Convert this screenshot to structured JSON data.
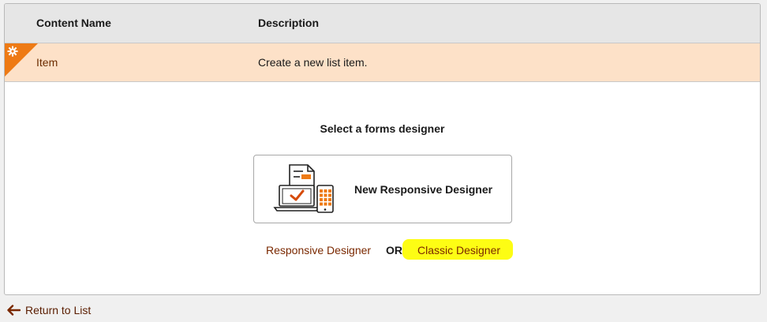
{
  "table": {
    "headers": {
      "content_name": "Content Name",
      "description": "Description"
    },
    "rows": [
      {
        "name": "Item",
        "description": "Create a new list item."
      }
    ]
  },
  "designer": {
    "title": "Select a forms designer",
    "card_label": "New Responsive Designer",
    "responsive_link": "Responsive Designer",
    "or_text": "OR",
    "classic_link": "Classic Designer"
  },
  "footer": {
    "return_label": "Return to List"
  },
  "colors": {
    "accent": "#ee7a14",
    "row_highlight": "#fde1c8",
    "link": "#7a2800",
    "marker_highlight": "#fdfd14"
  },
  "icons": {
    "row_menu": "gear-icon",
    "card_illustration": "devices-form-icon",
    "return": "arrow-left-icon"
  }
}
